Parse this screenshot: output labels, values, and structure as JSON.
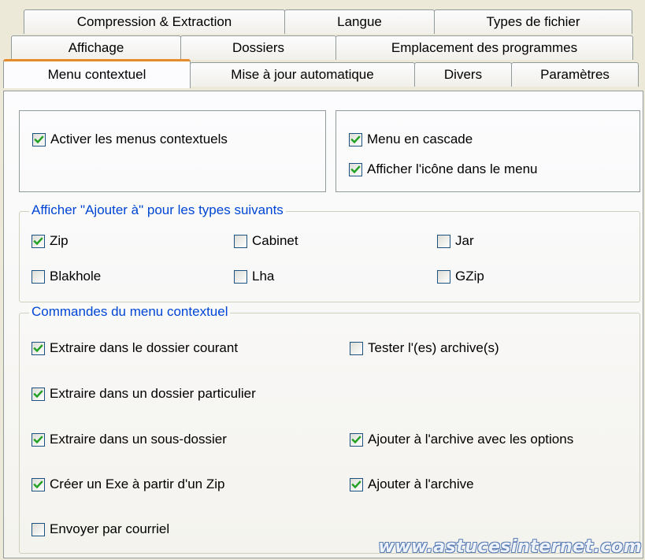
{
  "tabs": {
    "row1": [
      "Compression & Extraction",
      "Langue",
      "Types de fichier"
    ],
    "row2": [
      "Affichage",
      "Dossiers",
      "Emplacement des programmes"
    ],
    "row3": [
      "Menu contextuel",
      "Mise à jour automatique",
      "Divers",
      "Paramètres"
    ],
    "active": "Menu contextuel"
  },
  "context_menu": {
    "enable_label": "Activer les menus contextuels",
    "enable_checked": true
  },
  "cascade": {
    "cascade_label": "Menu en cascade",
    "cascade_checked": true,
    "icon_label": "Afficher l'icône dans le menu",
    "icon_checked": true
  },
  "add_to": {
    "legend": "Afficher \"Ajouter à\" pour les types suivants",
    "items": [
      {
        "label": "Zip",
        "checked": true
      },
      {
        "label": "Cabinet",
        "checked": false
      },
      {
        "label": "Jar",
        "checked": false
      },
      {
        "label": "Blakhole",
        "checked": false
      },
      {
        "label": "Lha",
        "checked": false
      },
      {
        "label": "GZip",
        "checked": false
      }
    ]
  },
  "commands": {
    "legend": "Commandes du menu contextuel",
    "items": [
      {
        "label": "Extraire dans le dossier courant",
        "checked": true
      },
      {
        "label": "Tester l'(es) archive(s)",
        "checked": false
      },
      {
        "label": "Extraire dans un dossier particulier",
        "checked": true
      },
      {
        "label": "Extraire dans un sous-dossier",
        "checked": true
      },
      {
        "label": "Ajouter à l'archive avec les options",
        "checked": true
      },
      {
        "label": "Créer un Exe à partir d'un Zip",
        "checked": true
      },
      {
        "label": "Ajouter à l'archive",
        "checked": true
      },
      {
        "label": "Envoyer par courriel",
        "checked": false
      }
    ]
  },
  "watermark": "www.astucesinternet.com",
  "colors": {
    "accent_tab": "#e68b2c",
    "legend_text": "#0046d5",
    "check": "#21a121"
  }
}
